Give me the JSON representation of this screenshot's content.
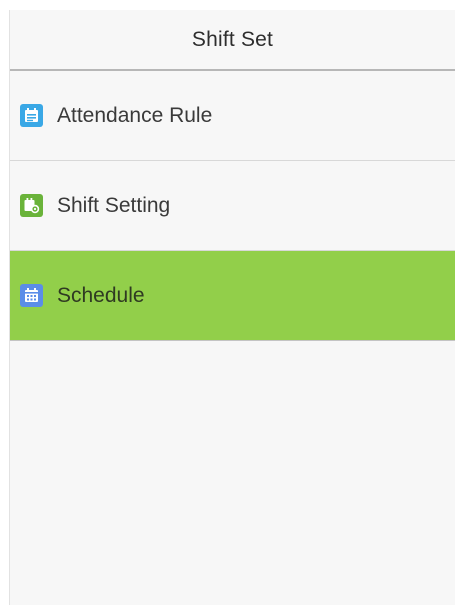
{
  "header": {
    "title": "Shift Set"
  },
  "menu": {
    "items": [
      {
        "label": "Attendance Rule",
        "icon": "calendar-list-icon",
        "icon_color": "#3aa8e6",
        "selected": false
      },
      {
        "label": "Shift Setting",
        "icon": "calendar-gear-icon",
        "icon_color": "#6ab33a",
        "selected": false
      },
      {
        "label": "Schedule",
        "icon": "calendar-grid-icon",
        "icon_color": "#5b8de8",
        "selected": true
      }
    ]
  },
  "colors": {
    "selected_background": "#92cf4a",
    "screen_background": "#f7f7f7",
    "header_divider": "#b7b7b7"
  }
}
